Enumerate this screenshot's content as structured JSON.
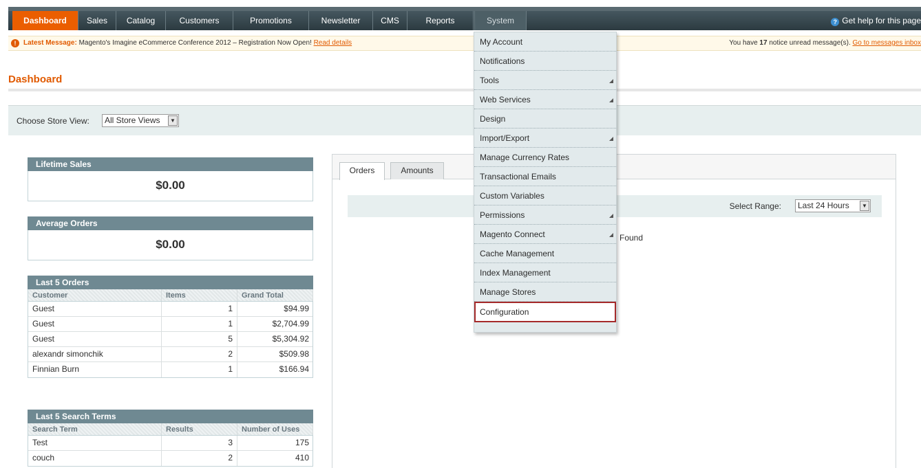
{
  "nav": {
    "items": [
      "Dashboard",
      "Sales",
      "Catalog",
      "Customers",
      "Promotions",
      "Newsletter",
      "CMS",
      "Reports",
      "System"
    ],
    "help": "Get help for this page"
  },
  "notice": {
    "label": "Latest Message:",
    "message": "Magento's Imagine eCommerce Conference 2012 – Registration Now Open!",
    "link": "Read details",
    "right_prefix": "You have ",
    "count": "17",
    "right_suffix": " notice unread message(s). ",
    "right_link": "Go to messages inbox"
  },
  "page": {
    "title": "Dashboard",
    "store_label": "Choose Store View:",
    "store_value": "All Store Views"
  },
  "lifetime_sales": {
    "title": "Lifetime Sales",
    "value": "$0.00"
  },
  "average_orders": {
    "title": "Average Orders",
    "value": "$0.00"
  },
  "last_orders": {
    "title": "Last 5 Orders",
    "headers": [
      "Customer",
      "Items",
      "Grand Total"
    ],
    "rows": [
      [
        "Guest",
        "1",
        "$94.99"
      ],
      [
        "Guest",
        "1",
        "$2,704.99"
      ],
      [
        "Guest",
        "5",
        "$5,304.92"
      ],
      [
        "alexandr simonchik",
        "2",
        "$509.98"
      ],
      [
        "Finnian Burn",
        "1",
        "$166.94"
      ]
    ]
  },
  "search_terms": {
    "title": "Last 5 Search Terms",
    "headers": [
      "Search Term",
      "Results",
      "Number of Uses"
    ],
    "rows": [
      [
        "Test",
        "3",
        "175"
      ],
      [
        "couch",
        "2",
        "410"
      ]
    ]
  },
  "chart": {
    "tabs": [
      "Orders",
      "Amounts"
    ],
    "range_label": "Select Range:",
    "range_value": "Last 24 Hours",
    "no_data": "Found"
  },
  "system_menu": {
    "items": [
      {
        "label": "My Account",
        "arrow": false
      },
      {
        "label": "Notifications",
        "arrow": false
      },
      {
        "label": "Tools",
        "arrow": true
      },
      {
        "label": "Web Services",
        "arrow": true
      },
      {
        "label": "Design",
        "arrow": false
      },
      {
        "label": "Import/Export",
        "arrow": true
      },
      {
        "label": "Manage Currency Rates",
        "arrow": false
      },
      {
        "label": "Transactional Emails",
        "arrow": false
      },
      {
        "label": "Custom Variables",
        "arrow": false
      },
      {
        "label": "Permissions",
        "arrow": true
      },
      {
        "label": "Magento Connect",
        "arrow": true
      },
      {
        "label": "Cache Management",
        "arrow": false
      },
      {
        "label": "Index Management",
        "arrow": false
      },
      {
        "label": "Manage Stores",
        "arrow": false
      },
      {
        "label": "Configuration",
        "arrow": false,
        "highlighted": true
      }
    ]
  },
  "colors": {
    "accent": "#eb5e00",
    "nav": "#2c3a40",
    "highlight_border": "#a52a2a"
  }
}
